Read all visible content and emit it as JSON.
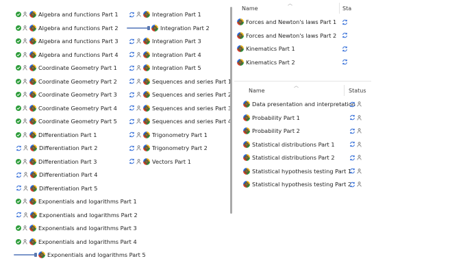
{
  "colors": {
    "synced_green": "#2e9d3b",
    "sync_blue": "#2f6bd8",
    "text": "#1f1f1f",
    "header_text": "#3a3a3a",
    "progress_blue": "#7a95c9"
  },
  "left_pane": {
    "column1": [
      {
        "name": "Algebra and functions Part 1",
        "status": "synced"
      },
      {
        "name": "Algebra and functions Part 2",
        "status": "synced"
      },
      {
        "name": "Algebra and functions Part 3",
        "status": "synced"
      },
      {
        "name": "Algebra and functions Part 4",
        "status": "synced"
      },
      {
        "name": "Coordinate Geometry Part 1",
        "status": "synced"
      },
      {
        "name": "Coordinate Geometry Part 2",
        "status": "synced"
      },
      {
        "name": "Coordinate Geometry Part 3",
        "status": "synced"
      },
      {
        "name": "Coordinate Geometry Part 4",
        "status": "synced"
      },
      {
        "name": "Coordinate Geometry Part 5",
        "status": "synced"
      },
      {
        "name": "Differentiation Part 1",
        "status": "synced"
      },
      {
        "name": "Differentiation Part 2",
        "status": "syncing"
      },
      {
        "name": "Differentiation Part 3",
        "status": "synced"
      },
      {
        "name": "Differentiation Part 4",
        "status": "syncing"
      },
      {
        "name": "Differentiation Part 5",
        "status": "syncing"
      },
      {
        "name": "Exponentials and logarithms Part 1",
        "status": "synced"
      },
      {
        "name": "Exponentials and logarithms Part 2",
        "status": "syncing"
      },
      {
        "name": "Exponentials and logarithms Part 3",
        "status": "synced"
      },
      {
        "name": "Exponentials and logarithms Part 4",
        "status": "synced"
      },
      {
        "name": "Exponentials and logarithms Part 5",
        "status": "uploading"
      }
    ],
    "column2": [
      {
        "name": "Integration Part 1",
        "status": "syncing"
      },
      {
        "name": "Integration Part 2",
        "status": "uploading"
      },
      {
        "name": "Integration Part 3",
        "status": "syncing"
      },
      {
        "name": "Integration Part 4",
        "status": "syncing"
      },
      {
        "name": "Integration Part 5",
        "status": "syncing"
      },
      {
        "name": "Sequences and series Part 1",
        "status": "syncing"
      },
      {
        "name": "Sequences and series Part 2",
        "status": "syncing"
      },
      {
        "name": "Sequences and series Part 3",
        "status": "syncing"
      },
      {
        "name": "Sequences and series Part 4",
        "status": "syncing"
      },
      {
        "name": "Trigonometry Part 1",
        "status": "syncing"
      },
      {
        "name": "Trigonometry Part 2",
        "status": "syncing"
      },
      {
        "name": "Vectors Part 1",
        "status": "syncing"
      }
    ]
  },
  "top_right": {
    "headers": {
      "name": "Name",
      "status": "Sta"
    },
    "items": [
      {
        "name": "Forces and Newton's laws Part 1",
        "status": "syncing"
      },
      {
        "name": "Forces and Newton's laws Part 2",
        "status": "syncing"
      },
      {
        "name": "Kinematics Part 1",
        "status": "syncing"
      },
      {
        "name": "Kinematics Part 2",
        "status": "syncing"
      }
    ]
  },
  "bottom_right": {
    "headers": {
      "name": "Name",
      "status": "Status"
    },
    "items": [
      {
        "name": "Data presentation and interpretation",
        "status": "syncing"
      },
      {
        "name": "Probability Part 1",
        "status": "syncing"
      },
      {
        "name": "Probability Part 2",
        "status": "syncing"
      },
      {
        "name": "Statistical distributions Part 1",
        "status": "syncing"
      },
      {
        "name": "Statistical distributions Part 2",
        "status": "syncing"
      },
      {
        "name": "Statistical hypothesis testing Part 1",
        "status": "syncing"
      },
      {
        "name": "Statistical hypothesis testing Part 2",
        "status": "syncing"
      }
    ]
  }
}
